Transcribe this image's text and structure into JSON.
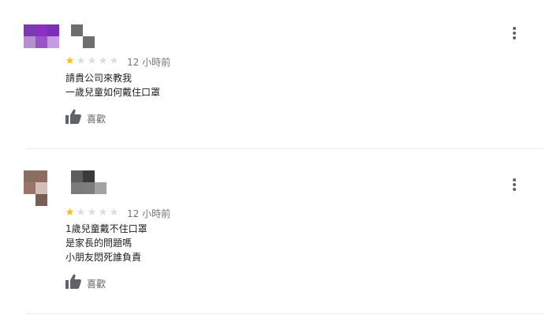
{
  "reviews": [
    {
      "avatar_pixels": [
        "#7b3ab0",
        "#8a2fc0",
        "#7b2eb6",
        "#b68fcf",
        "#9a55c5",
        "#c79be0",
        "",
        "",
        ""
      ],
      "name_pixels": [
        "#6d6d6d",
        "",
        "",
        "",
        "#6f6f6f",
        ""
      ],
      "rating": 1,
      "rating_max": 5,
      "time": "12 小時前",
      "lines": [
        "請貴公司來教我",
        "一歲兒童如何戴住口罩"
      ],
      "like_label": "喜歡"
    },
    {
      "avatar_pixels": [
        "#8a6e62",
        "#8c6d60",
        "",
        "#9a7468",
        "#d2bfb8",
        "",
        "",
        "#7b5e52",
        ""
      ],
      "name_pixels": [
        "#5d5d5d",
        "#3a3a3a",
        "",
        "#7a7a7a",
        "#7d7d7d",
        "#a3a3a3"
      ],
      "rating": 1,
      "rating_max": 5,
      "time": "12 小時前",
      "lines": [
        "1歲兒童戴不住口罩",
        "是家長的問題嗎",
        "小朋友悶死誰負責"
      ],
      "like_label": "喜歡"
    }
  ],
  "colors": {
    "star_filled": "#fbbc04",
    "star_empty": "#dadce0",
    "icon_gray": "#5f6368"
  },
  "icons": {
    "more": "more-vert-icon",
    "like": "thumb-up-icon",
    "star": "star-icon"
  }
}
